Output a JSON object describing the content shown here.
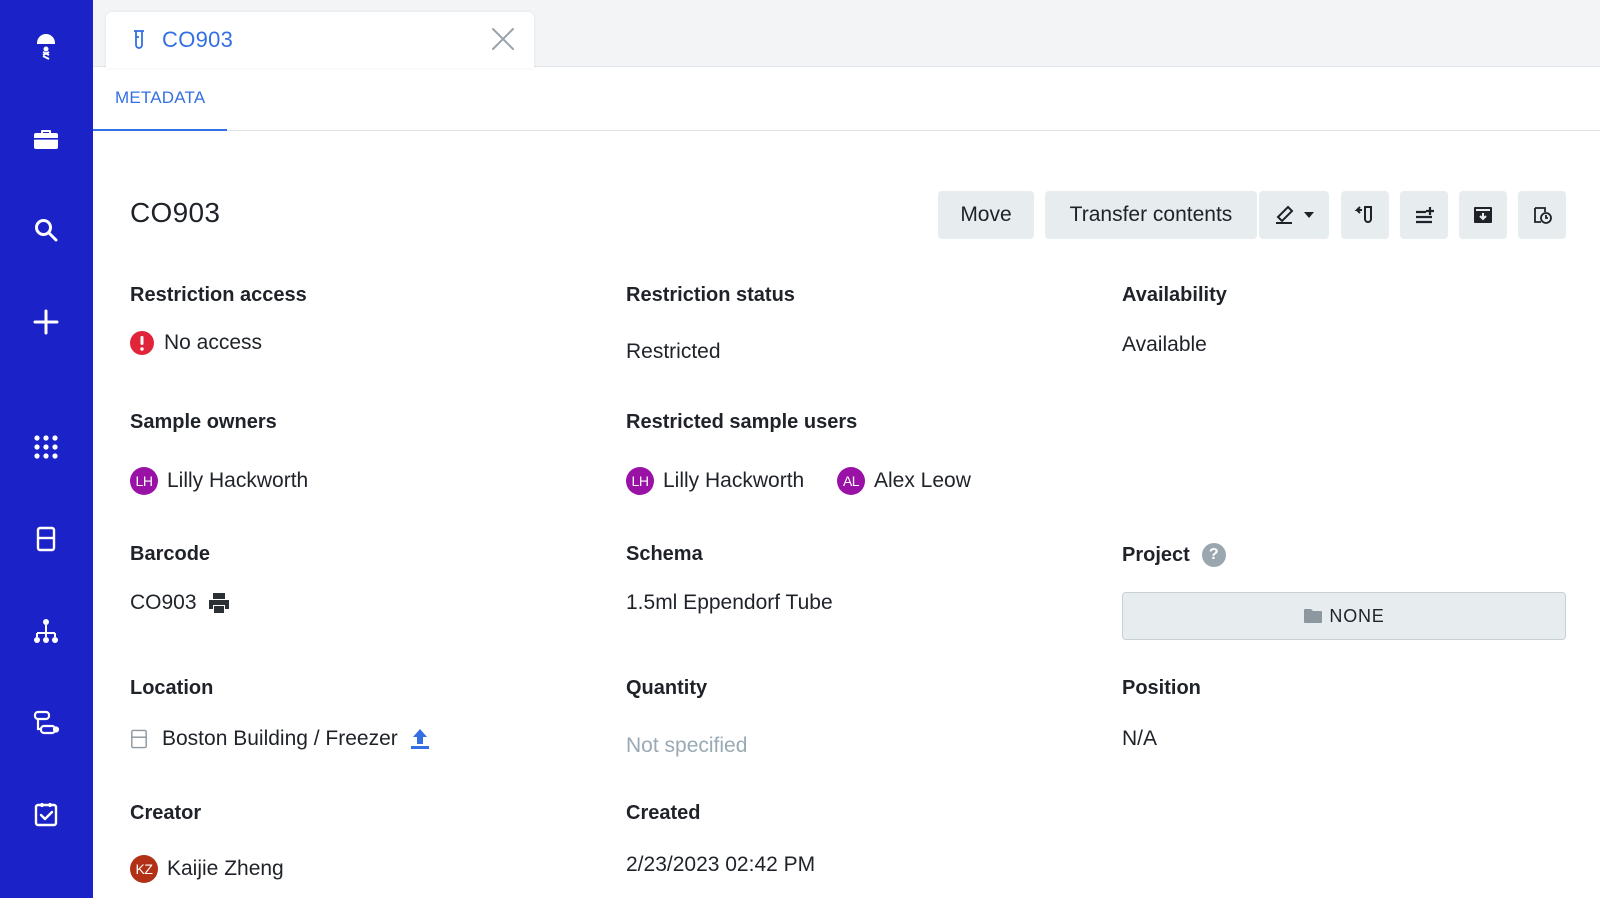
{
  "tab": {
    "title": "CO903",
    "close_icon": "close-icon",
    "tube_icon": "sample-tube-icon"
  },
  "subtabs": [
    {
      "label": "METADATA",
      "active": true
    }
  ],
  "sidebar": {
    "items": [
      {
        "name": "logo-icon"
      },
      {
        "name": "briefcase-icon"
      },
      {
        "name": "search-icon"
      },
      {
        "name": "plus-icon"
      },
      {
        "name": "apps-grid-icon"
      },
      {
        "name": "storage-box-icon"
      },
      {
        "name": "hierarchy-icon"
      },
      {
        "name": "workflow-icon"
      },
      {
        "name": "task-checklist-icon"
      }
    ]
  },
  "entity": {
    "title": "CO903"
  },
  "toolbar": {
    "move_label": "Move",
    "transfer_label": "Transfer contents"
  },
  "fields": {
    "restriction_access": {
      "label": "Restriction access",
      "value": "No access"
    },
    "restriction_status": {
      "label": "Restriction status",
      "value": "Restricted"
    },
    "availability": {
      "label": "Availability",
      "value": "Available"
    },
    "sample_owners": {
      "label": "Sample owners",
      "users": [
        {
          "initials": "LH",
          "name": "Lilly Hackworth"
        }
      ]
    },
    "restricted_users": {
      "label": "Restricted sample users",
      "users": [
        {
          "initials": "LH",
          "name": "Lilly Hackworth"
        },
        {
          "initials": "AL",
          "name": "Alex Leow"
        }
      ]
    },
    "barcode": {
      "label": "Barcode",
      "value": "CO903"
    },
    "schema": {
      "label": "Schema",
      "value": "1.5ml Eppendorf Tube"
    },
    "project": {
      "label": "Project",
      "help": "?",
      "value": "NONE"
    },
    "location": {
      "label": "Location",
      "value": "Boston Building / Freezer"
    },
    "quantity": {
      "label": "Quantity",
      "value": "Not specified"
    },
    "position": {
      "label": "Position",
      "value": "N/A"
    },
    "creator": {
      "label": "Creator",
      "initials": "KZ",
      "name": "Kaijie Zheng"
    },
    "created": {
      "label": "Created",
      "value": "2/23/2023 02:42 PM"
    }
  },
  "colors": {
    "sidebar": "#1b22c8",
    "accent": "#3470e4",
    "error": "#e0243a",
    "avatar_purple": "#9a11a6",
    "avatar_red": "#b23016",
    "muted": "#9aaab5"
  }
}
